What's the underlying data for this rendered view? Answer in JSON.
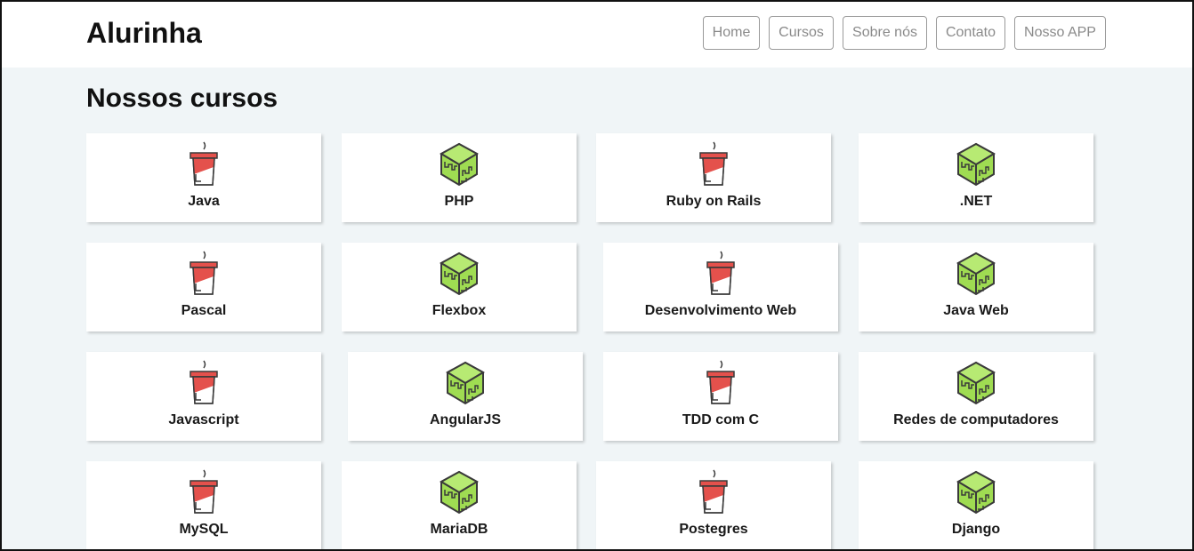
{
  "header": {
    "brand": "Alurinha",
    "nav": [
      {
        "label": "Home"
      },
      {
        "label": "Cursos"
      },
      {
        "label": "Sobre nós"
      },
      {
        "label": "Contato"
      },
      {
        "label": "Nosso APP"
      }
    ]
  },
  "main": {
    "title": "Nossos cursos",
    "courses": [
      {
        "label": "Java",
        "icon": "coffee-cup-icon"
      },
      {
        "label": "PHP",
        "icon": "green-cube-icon"
      },
      {
        "label": "Ruby on Rails",
        "icon": "coffee-cup-icon"
      },
      {
        "label": ".NET",
        "icon": "green-cube-icon"
      },
      {
        "label": "Pascal",
        "icon": "coffee-cup-icon"
      },
      {
        "label": "Flexbox",
        "icon": "green-cube-icon"
      },
      {
        "label": "Desenvolvimento Web",
        "icon": "coffee-cup-icon"
      },
      {
        "label": "Java Web",
        "icon": "green-cube-icon"
      },
      {
        "label": "Javascript",
        "icon": "coffee-cup-icon"
      },
      {
        "label": "AngularJS",
        "icon": "green-cube-icon"
      },
      {
        "label": "TDD com C",
        "icon": "coffee-cup-icon"
      },
      {
        "label": "Redes de computadores",
        "icon": "green-cube-icon"
      },
      {
        "label": "MySQL",
        "icon": "coffee-cup-icon"
      },
      {
        "label": "MariaDB",
        "icon": "green-cube-icon"
      },
      {
        "label": "Postegres",
        "icon": "coffee-cup-icon"
      },
      {
        "label": "Django",
        "icon": "green-cube-icon"
      }
    ]
  },
  "colors": {
    "background": "#f0f5f7",
    "cup_red": "#e4514c",
    "cube_green": "#9fdc52",
    "outline": "#3a3a3a"
  }
}
